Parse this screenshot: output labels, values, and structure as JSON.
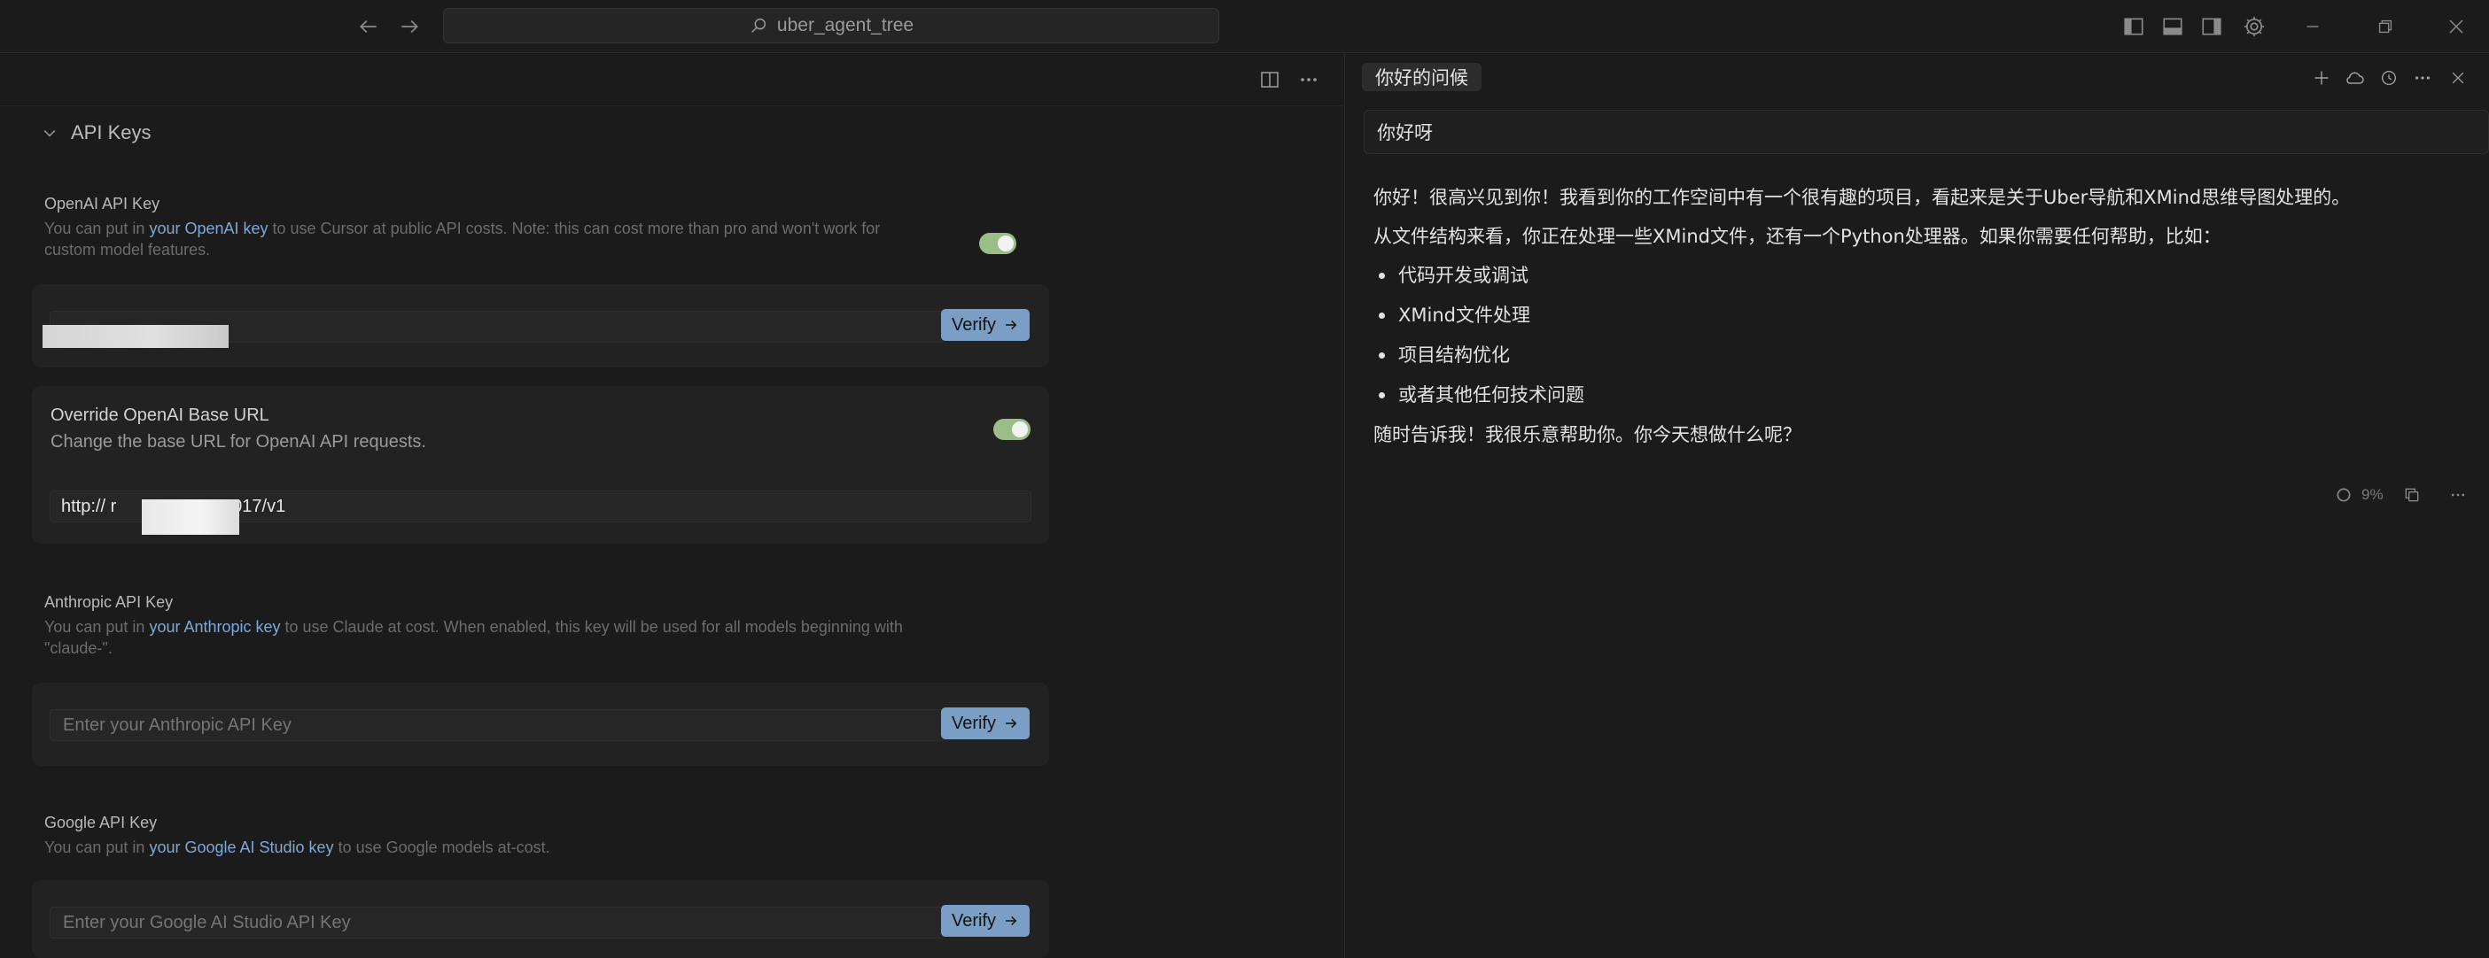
{
  "titlebar": {
    "search_text": "uber_agent_tree"
  },
  "api_keys": {
    "section_title": "API Keys",
    "openai": {
      "title": "OpenAI API Key",
      "desc_pre": "You can put in ",
      "desc_link": "your OpenAI key",
      "desc_post": " to use Cursor at public API costs. Note: this can cost more than pro and won't work for",
      "desc_line2": "custom model features.",
      "enabled": true,
      "verify_label": "Verify"
    },
    "base_url": {
      "title": "Override OpenAI Base URL",
      "desc": "Change the base URL for OpenAI API requests.",
      "value_pre": "http:// r",
      "value_post": "28:8017/v1",
      "enabled": true
    },
    "anthropic": {
      "title": "Anthropic API Key",
      "desc_pre": "You can put in ",
      "desc_link": "your Anthropic key",
      "desc_post": " to use Claude at cost. When enabled, this key will be used for all models beginning with",
      "desc_line2": "\"claude-\".",
      "placeholder": "Enter your Anthropic API Key",
      "verify_label": "Verify"
    },
    "google": {
      "title": "Google API Key",
      "desc_pre": "You can put in ",
      "desc_link": "your Google AI Studio key",
      "desc_post": " to use Google models at-cost.",
      "placeholder": "Enter your Google AI Studio API Key",
      "verify_label": "Verify"
    }
  },
  "chat": {
    "tab_title": "你好的问候",
    "user_message": "你好呀",
    "reply_p1": "你好！很高兴见到你！我看到你的工作空间中有一个很有趣的项目，看起来是关于Uber导航和XMind思维导图处理的。",
    "reply_p2": "从文件结构来看，你正在处理一些XMind文件，还有一个Python处理器。如果你需要任何帮助，比如：",
    "reply_items": [
      "代码开发或调试",
      "XMind文件处理",
      "项目结构优化",
      "或者其他任何技术问题"
    ],
    "reply_p3": "随时告诉我！我很乐意帮助你。你今天想做什么呢？",
    "context_percent": "9%"
  }
}
